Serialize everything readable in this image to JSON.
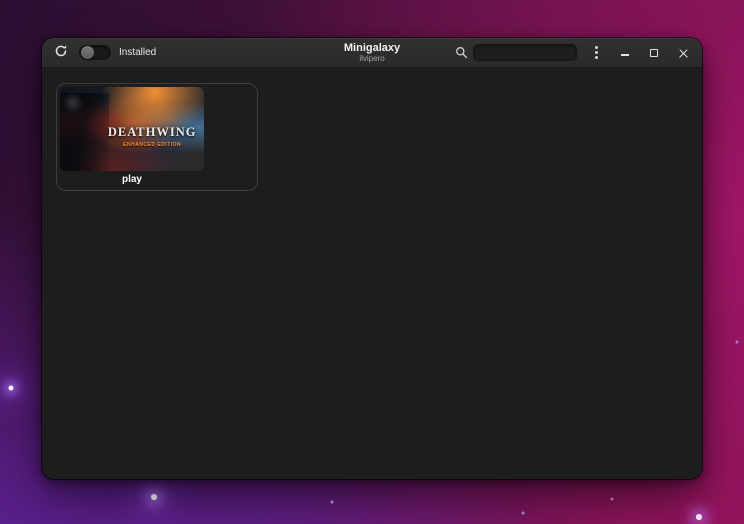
{
  "header": {
    "title": "Minigalaxy",
    "subtitle": "ilvipero",
    "installed_toggle_label": "Installed",
    "installed_toggle_state": "off",
    "search_value": "",
    "search_placeholder": ""
  },
  "colors": {
    "desktop_gradient_start": "#2a0f33",
    "desktop_gradient_end": "#8f1359",
    "headerbar": "#2d2d2d",
    "content_background": "#1d1d1d",
    "cover_accent_orange": "#ff8c2e",
    "cover_accent_blue": "#5296d2"
  },
  "library": {
    "games": [
      {
        "cover_title": "DEATHWING",
        "cover_subtitle": "ENHANCED EDITION",
        "action_label": "play"
      }
    ]
  }
}
